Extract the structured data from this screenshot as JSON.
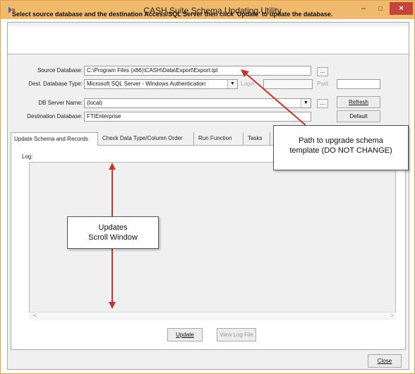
{
  "window": {
    "title": "CASH Suite Schema Updating Utility",
    "minimize": "–",
    "maximize": "□",
    "close": "×"
  },
  "instruction": "Select source database and the destination Access/SQL Server then click 'Update' to update the database.",
  "form": {
    "source_label": "Source Database:",
    "source_value": "C:\\Program Files (x86)\\CASH\\Data\\Export\\Export.tpl",
    "browse_label": "...",
    "dest_type_label": "Dest. Database Type:",
    "dest_type_value": "Microsoft SQL Server - Windows Authentication",
    "login_label": "Login:",
    "pwd_label": "Pwd:",
    "server_label": "DB Server Name:",
    "server_value": "(local)",
    "refresh_label": "Refresh",
    "dest_db_label": "Destination Database:",
    "dest_db_value": "FTIEnterprise",
    "default_label": "Default"
  },
  "tabs": [
    {
      "label": "Update Schema and Records"
    },
    {
      "label": "Check Data Type/Column Order"
    },
    {
      "label": "Run Function"
    },
    {
      "label": "Tasks"
    }
  ],
  "log": {
    "label": "Log:",
    "scroll_left": "<",
    "scroll_right": ">"
  },
  "buttons": {
    "update": "Update",
    "view_log": "View Log File",
    "close": "Close"
  },
  "callouts": {
    "path_line1": "Path to upgrade schema",
    "path_line2": "template (DO NOT CHANGE)",
    "log_line1": "Updates",
    "log_line2": "Scroll Window"
  },
  "colors": {
    "titlebar": "#f0ba6c",
    "close_button": "#c6453b",
    "annotation_arrow": "#c0392b"
  }
}
